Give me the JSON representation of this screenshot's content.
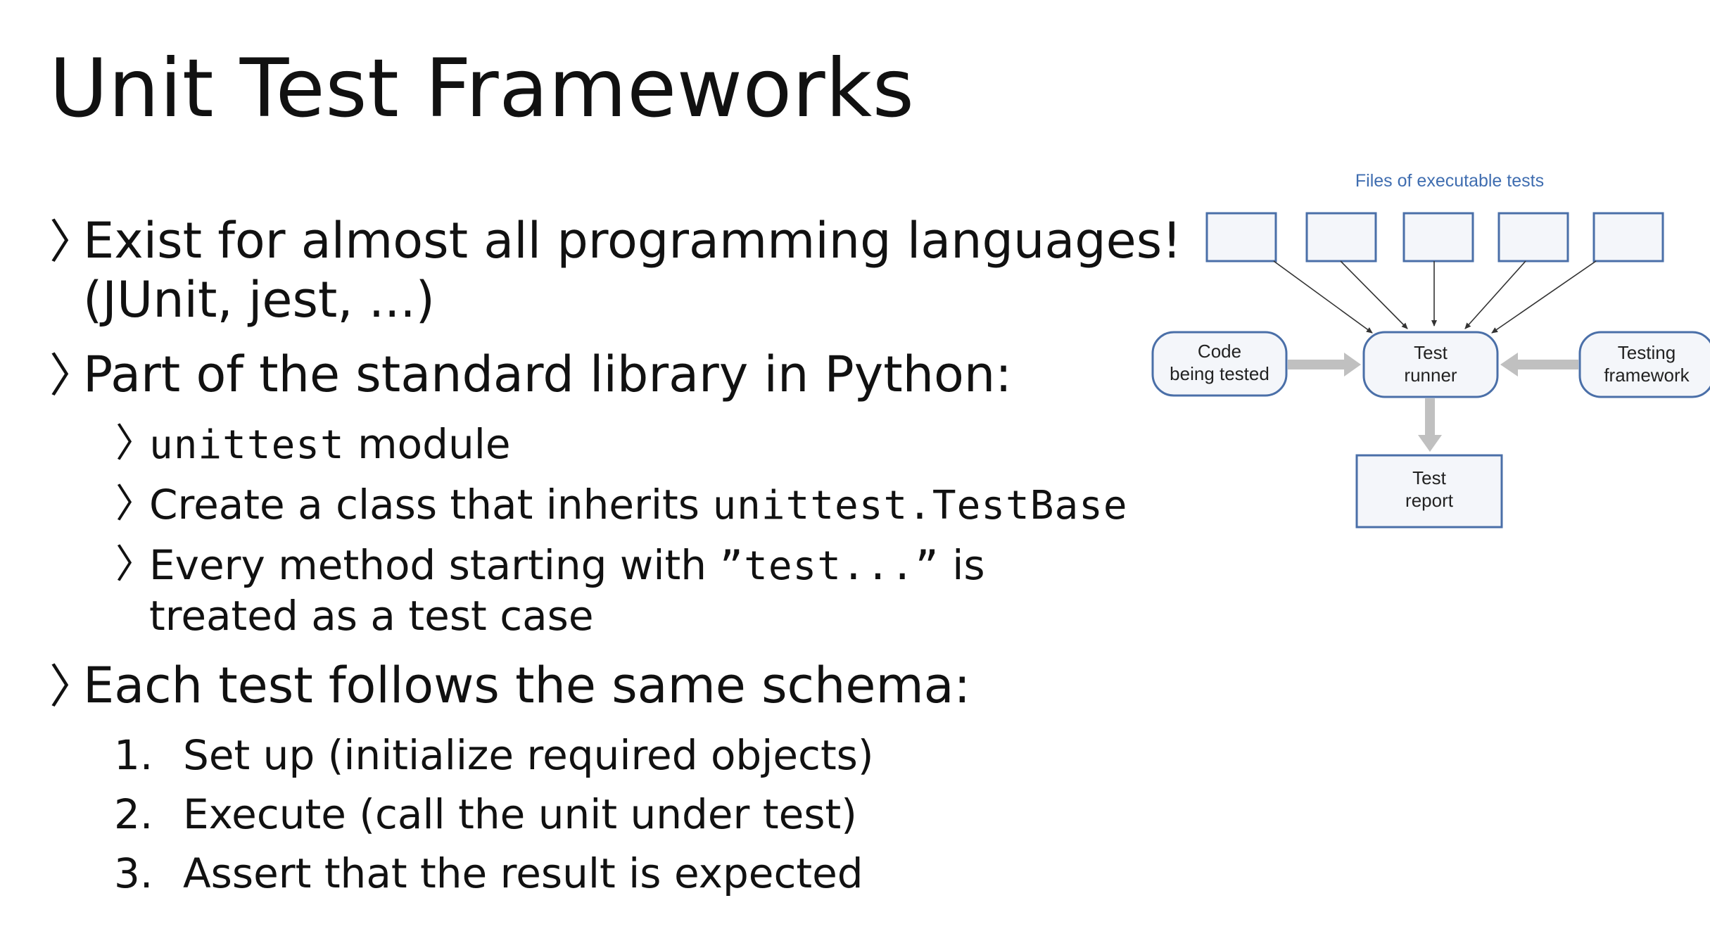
{
  "slide": {
    "title": "Unit Test Frameworks"
  },
  "bullets": {
    "marker": "〉",
    "b1": {
      "line1": "Exist for almost all programming languages!",
      "line2": "(JUnit, jest, ...)"
    },
    "b2": {
      "text": "Part of the standard library in Python:",
      "sub1": {
        "code": "unittest",
        "text": " module"
      },
      "sub2": {
        "text": "Create a class that inherits ",
        "code": "unittest.TestBase"
      },
      "sub3": {
        "text1": "Every method starting with ",
        "code": "”test...”",
        "text2": " is",
        "line2": "treated as a test case"
      }
    },
    "b3": {
      "text": "Each test follows the same schema:",
      "steps": [
        {
          "num": "1.",
          "text": "Set up (initialize required objects)"
        },
        {
          "num": "2.",
          "text": "Execute (call the unit under test)"
        },
        {
          "num": "3.",
          "text": "Assert that the result is expected"
        }
      ]
    }
  },
  "diagram": {
    "files_label": "Files of executable tests",
    "code_label": [
      "Code",
      "being tested"
    ],
    "runner_label": [
      "Test",
      "runner"
    ],
    "framework_label": [
      "Testing",
      "framework"
    ],
    "report_label": [
      "Test",
      "report"
    ],
    "colors": {
      "box_border": "#4a6fa8",
      "label_blue": "#3f6db0",
      "arrow_gray": "#c0c0c0"
    }
  }
}
